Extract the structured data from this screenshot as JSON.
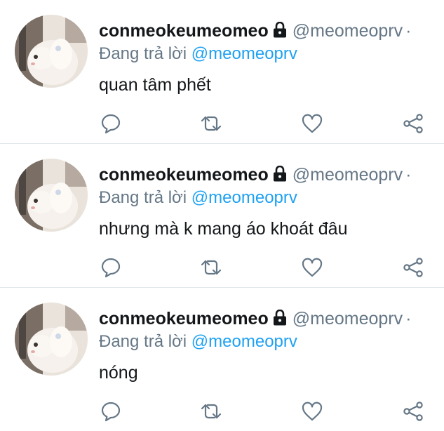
{
  "colors": {
    "name": "#14171a",
    "secondary": "#657786",
    "mention": "#1da1f2",
    "divider": "#e1e8ed",
    "icon": "#657786"
  },
  "icons": {
    "lock": "lock-icon",
    "reply": "reply-icon",
    "retweet": "retweet-icon",
    "like": "heart-icon",
    "share": "share-icon"
  },
  "tweets": [
    {
      "display_name": "conmeokeumeomeo",
      "handle": "@meomeoprv",
      "separator": "·",
      "reply_prefix": "Đang trả lời",
      "reply_to": "@meomeoprv",
      "text": "quan tâm phết"
    },
    {
      "display_name": "conmeokeumeomeo",
      "handle": "@meomeoprv",
      "separator": "·",
      "reply_prefix": "Đang trả lời",
      "reply_to": "@meomeoprv",
      "text": "nhưng mà k mang áo khoát đâu"
    },
    {
      "display_name": "conmeokeumeomeo",
      "handle": "@meomeoprv",
      "separator": "·",
      "reply_prefix": "Đang trả lời",
      "reply_to": "@meomeoprv",
      "text": "nóng"
    }
  ]
}
